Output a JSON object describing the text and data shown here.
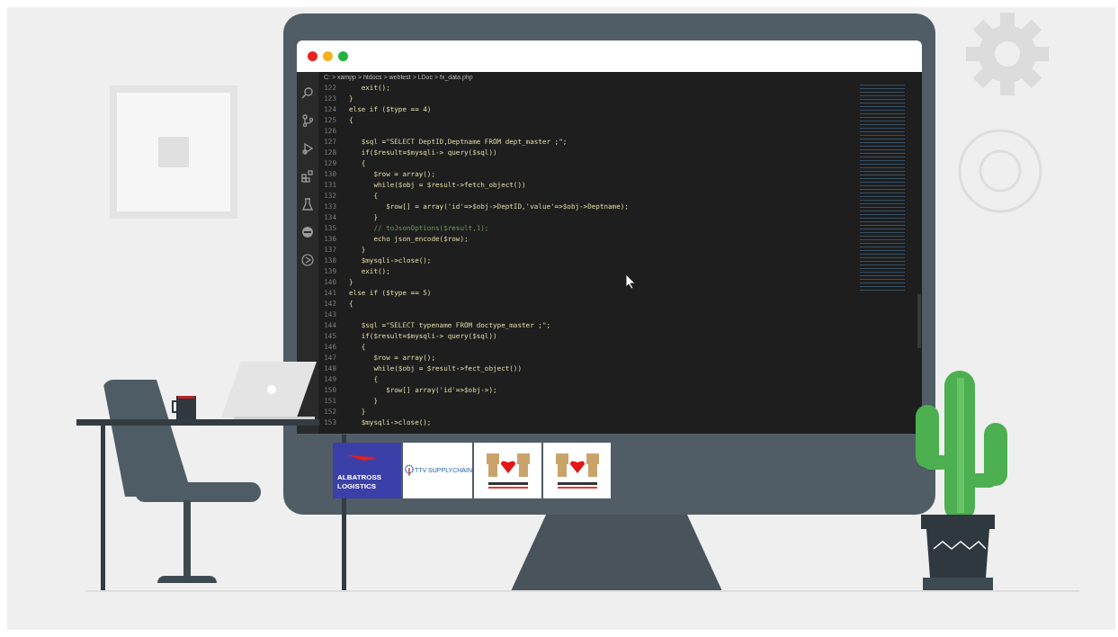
{
  "editor": {
    "breadcrumb": "C: > xampp > htdocs > webtest > LDoc > fx_data.php",
    "lines": [
      {
        "number": "122",
        "kind": "code",
        "text": "   exit();"
      },
      {
        "number": "123",
        "kind": "code",
        "text": "}"
      },
      {
        "number": "124",
        "kind": "code",
        "text": "else if ($type == 4)"
      },
      {
        "number": "125",
        "kind": "code",
        "text": "{"
      },
      {
        "number": "126"
      },
      {
        "number": "127",
        "kind": "code",
        "text": "   $sql =\"SELECT DeptID,Deptname FROM dept_master ;\";"
      },
      {
        "number": "128",
        "kind": "code",
        "text": "   if($result=$mysqli-> query($sql))"
      },
      {
        "number": "129",
        "kind": "code",
        "text": "   {"
      },
      {
        "number": "130",
        "kind": "code",
        "text": "      $row = array();"
      },
      {
        "number": "131",
        "kind": "code",
        "text": "      while($obj = $result->fetch_object())"
      },
      {
        "number": "132",
        "kind": "code",
        "text": "      {"
      },
      {
        "number": "133",
        "kind": "code",
        "text": "         $row[] = array('id'=>$obj->DeptID,'value'=>$obj->Deptname);"
      },
      {
        "number": "134",
        "kind": "code",
        "text": "      }"
      },
      {
        "number": "135",
        "kind": "comment",
        "text": "      // toJsonOptions($result,1);"
      },
      {
        "number": "136",
        "kind": "code",
        "text": "      echo json_encode($row);"
      },
      {
        "number": "137",
        "kind": "code",
        "text": "   }"
      },
      {
        "number": "138",
        "kind": "code",
        "text": "   $mysqli->close();"
      },
      {
        "number": "139",
        "kind": "code",
        "text": "   exit();"
      },
      {
        "number": "140",
        "kind": "code",
        "text": "}"
      },
      {
        "number": "141",
        "kind": "code",
        "text": "else if ($type == 5)"
      },
      {
        "number": "142",
        "kind": "code",
        "text": "{"
      },
      {
        "number": "143"
      },
      {
        "number": "144",
        "kind": "code",
        "text": "   $sql =\"SELECT typename FROM doctype_master ;\";"
      },
      {
        "number": "145",
        "kind": "code",
        "text": "   if($result=$mysqli-> query($sql))"
      },
      {
        "number": "146",
        "kind": "code",
        "text": "   {"
      },
      {
        "number": "147",
        "kind": "code",
        "text": "      $row = array();"
      },
      {
        "number": "148",
        "kind": "code",
        "text": "      while($obj = $result->fect_object())"
      },
      {
        "number": "149",
        "kind": "code",
        "text": "      {"
      },
      {
        "number": "150",
        "kind": "code",
        "text": "         $row[] array('id'=>$obj->);"
      },
      {
        "number": "151",
        "kind": "code",
        "text": "      }"
      },
      {
        "number": "152",
        "kind": "code",
        "text": "   }"
      },
      {
        "number": "153",
        "kind": "code",
        "text": "   $mysqli->close();"
      }
    ]
  },
  "logos": [
    {
      "kind": "albatross",
      "lines": [
        "ALBATROSS",
        "LOGISTICS"
      ]
    },
    {
      "kind": "ttv",
      "lines": [
        "TTV SUPPLYCHAIN"
      ]
    },
    {
      "kind": "dolls"
    },
    {
      "kind": "dolls"
    }
  ]
}
